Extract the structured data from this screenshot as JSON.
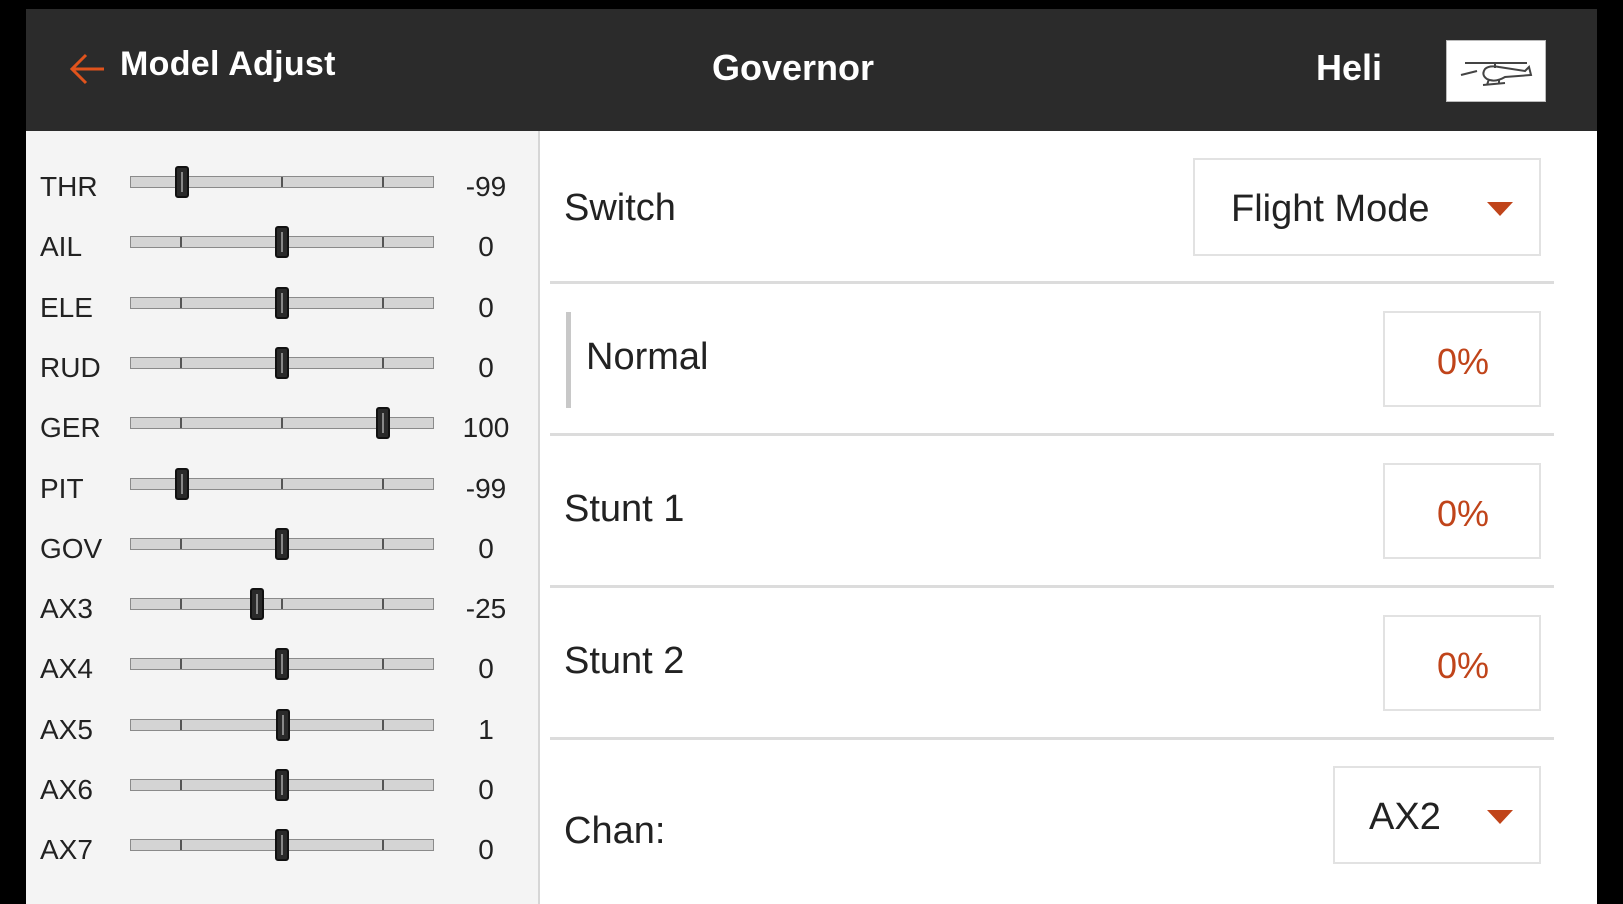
{
  "header": {
    "back_label": "Model Adjust",
    "title": "Governor",
    "model_type": "Heli",
    "accent_color": "#e0531c"
  },
  "channels": [
    {
      "label": "THR",
      "value": "-99",
      "position": -99
    },
    {
      "label": "AIL",
      "value": "0",
      "position": 0
    },
    {
      "label": "ELE",
      "value": "0",
      "position": 0
    },
    {
      "label": "RUD",
      "value": "0",
      "position": 0
    },
    {
      "label": "GER",
      "value": "100",
      "position": 100
    },
    {
      "label": "PIT",
      "value": "-99",
      "position": -99
    },
    {
      "label": "GOV",
      "value": "0",
      "position": 0
    },
    {
      "label": "AX3",
      "value": "-25",
      "position": -25
    },
    {
      "label": "AX4",
      "value": "0",
      "position": 0
    },
    {
      "label": "AX5",
      "value": "1",
      "position": 1
    },
    {
      "label": "AX6",
      "value": "0",
      "position": 0
    },
    {
      "label": "AX7",
      "value": "0",
      "position": 0
    }
  ],
  "switch": {
    "label": "Switch",
    "selected": "Flight Mode"
  },
  "modes": [
    {
      "label": "Normal",
      "value": "0%"
    },
    {
      "label": "Stunt 1",
      "value": "0%"
    },
    {
      "label": "Stunt 2",
      "value": "0%"
    }
  ],
  "channel_select": {
    "label": "Chan:",
    "selected": "AX2"
  },
  "colors": {
    "header_bg": "#2b2b2b",
    "value_accent": "#c0441a"
  },
  "icons": {
    "back": "arrow-left-icon",
    "model": "helicopter-icon",
    "dropdown": "caret-down-icon"
  }
}
